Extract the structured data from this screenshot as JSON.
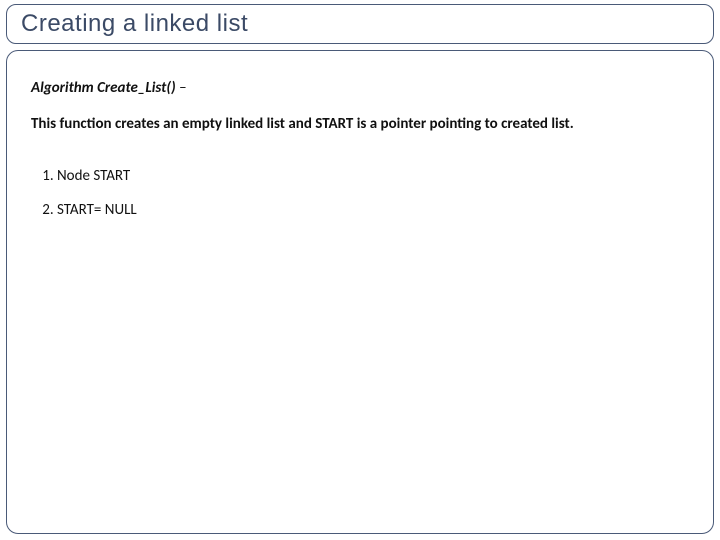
{
  "title": "Creating a linked list",
  "algorithm": {
    "name": "Algorithm Create_List()",
    "dash": " – "
  },
  "description": "This function creates an empty linked list and START is a pointer pointing to created list.",
  "steps": {
    "s1": "Node START",
    "s2": "START= NULL"
  }
}
